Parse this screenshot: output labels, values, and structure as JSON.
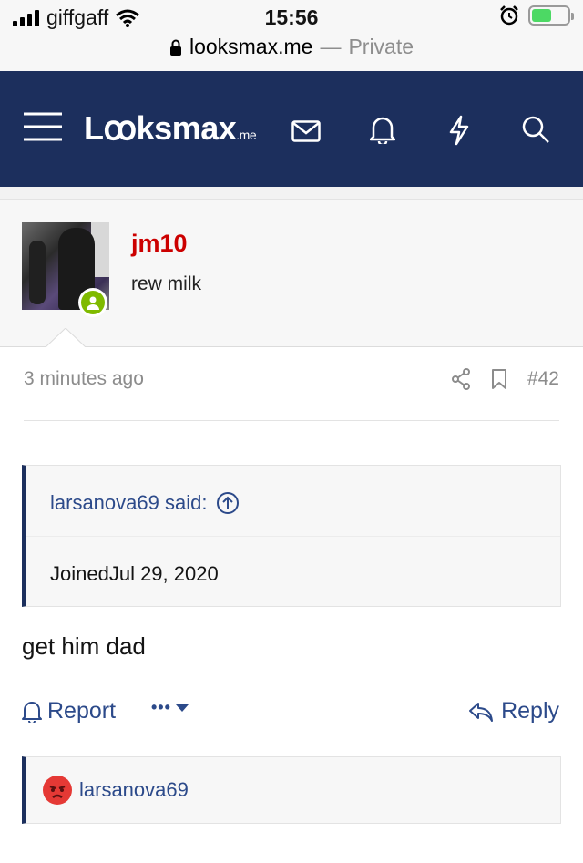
{
  "status": {
    "carrier": "giffgaff",
    "time": "15:56",
    "url": "looksmax.me",
    "mode_sep": "—",
    "mode": "Private",
    "battery_level": 0.55
  },
  "nav": {
    "logo_main": "Lꝏksmax",
    "logo_suffix": ".me",
    "icons": [
      "menu-icon",
      "mail-icon",
      "bell-icon",
      "lightning-icon",
      "search-icon"
    ],
    "brand_color": "#1c2f5d"
  },
  "post": {
    "username": "jm10",
    "user_title": "rew milk",
    "time": "3 minutes ago",
    "number": "#42",
    "quote": {
      "author_label": "larsanova69 said:",
      "text": "JoinedJul 29, 2020"
    },
    "message": "get him dad",
    "actions": {
      "report": "Report",
      "more": "•••",
      "reply": "Reply"
    },
    "reaction_user": "larsanova69"
  }
}
